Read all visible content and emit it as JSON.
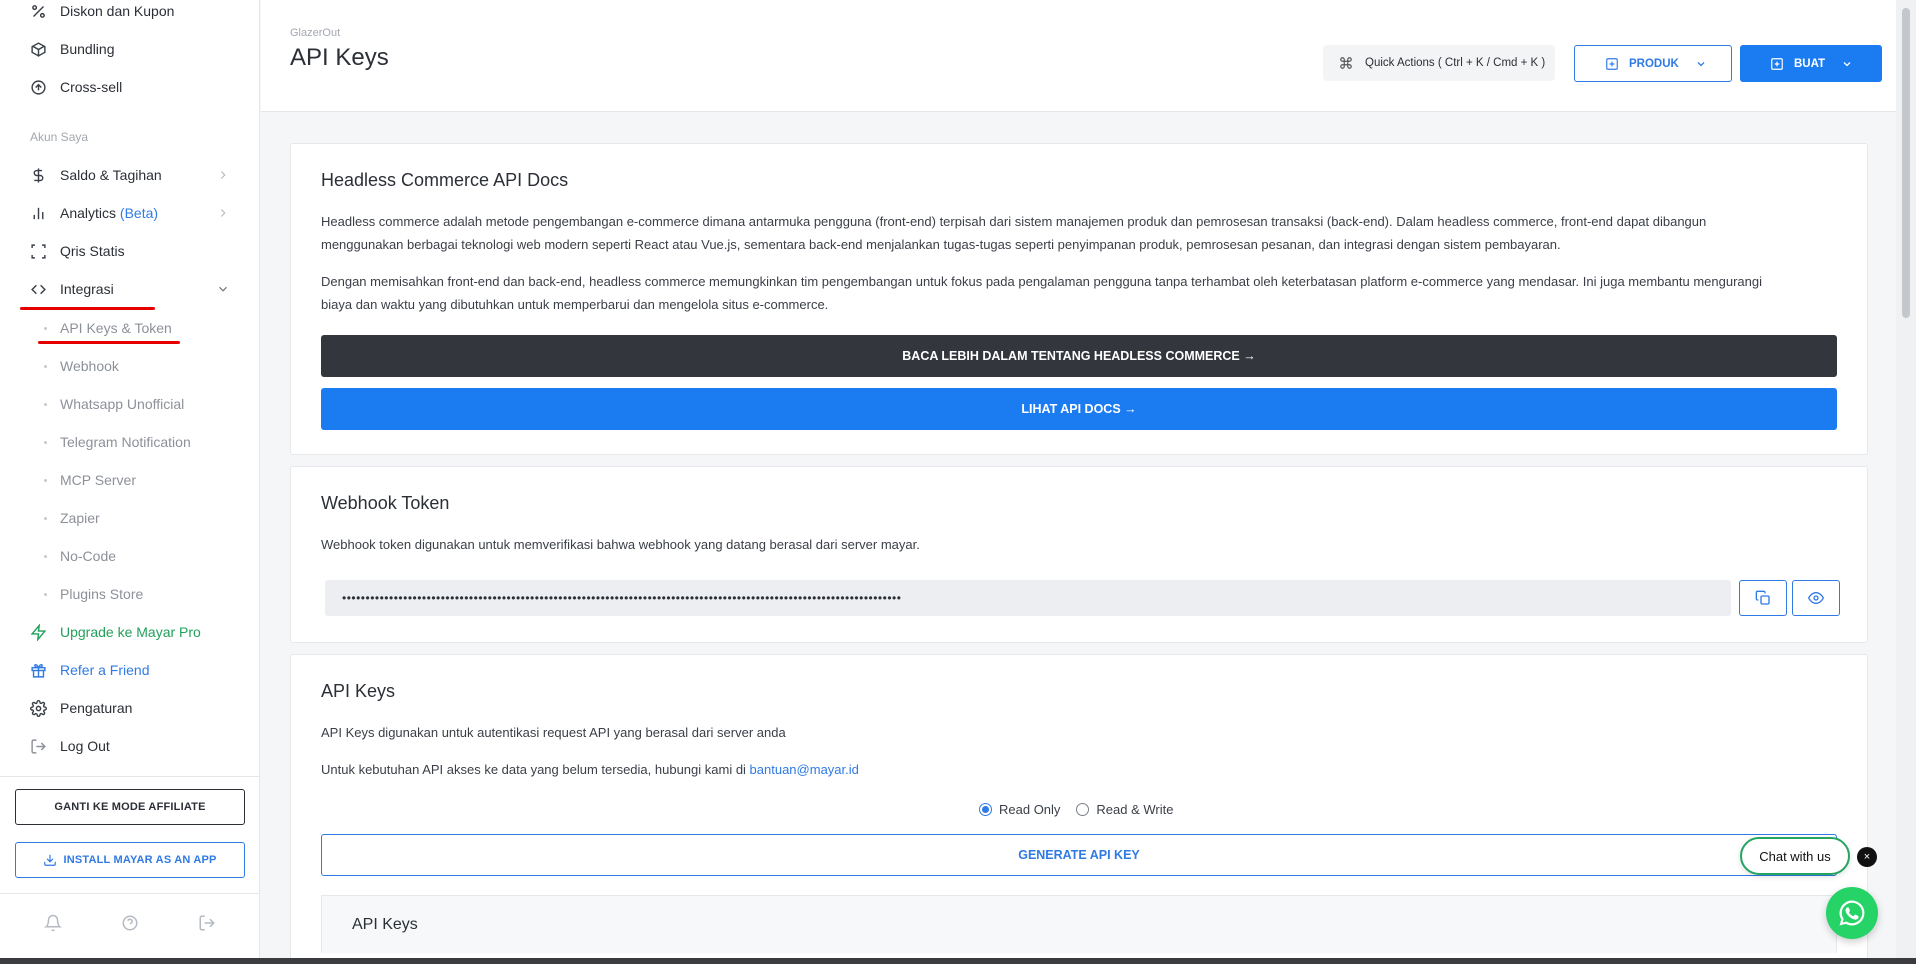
{
  "sidebar": {
    "items_top": [
      {
        "label": "Diskon dan Kupon",
        "icon": "percent-icon"
      },
      {
        "label": "Bundling",
        "icon": "box-icon"
      },
      {
        "label": "Cross-sell",
        "icon": "arrow-up-circle-icon"
      }
    ],
    "section_label": "Akun Saya",
    "items_account": [
      {
        "label": "Saldo & Tagihan",
        "icon": "dollar-icon"
      },
      {
        "label": "Analytics ",
        "beta": "(Beta)",
        "icon": "bar-chart-icon"
      },
      {
        "label": "Qris Statis",
        "icon": "scan-icon"
      },
      {
        "label": "Integrasi",
        "icon": "code-icon"
      }
    ],
    "sub_items": [
      {
        "label": "API Keys & Token"
      },
      {
        "label": "Webhook"
      },
      {
        "label": "Whatsapp Unofficial"
      },
      {
        "label": "Telegram Notification"
      },
      {
        "label": "MCP Server"
      },
      {
        "label": "Zapier"
      },
      {
        "label": "No-Code"
      },
      {
        "label": "Plugins Store"
      }
    ],
    "items_bottom": [
      {
        "label": "Upgrade ke Mayar Pro",
        "icon": "lightning-icon"
      },
      {
        "label": "Refer a Friend",
        "icon": "gift-icon"
      },
      {
        "label": "Pengaturan",
        "icon": "gear-icon"
      },
      {
        "label": "Log Out",
        "icon": "logout-icon"
      }
    ],
    "affiliate_button": "GANTI KE MODE AFFILIATE",
    "install_button": "INSTALL MAYAR AS AN APP"
  },
  "header": {
    "store_name": "GlazerOut",
    "title": "API Keys",
    "quick_actions": "Quick Actions ( Ctrl + K / Cmd + K )",
    "produk_button": "PRODUK",
    "buat_button": "BUAT"
  },
  "headless": {
    "title": "Headless Commerce API Docs",
    "para1": "Headless commerce adalah metode pengembangan e-commerce dimana antarmuka pengguna (front-end) terpisah dari sistem manajemen produk dan pemrosesan transaksi (back-end). Dalam headless commerce, front-end dapat dibangun menggunakan berbagai teknologi web modern seperti React atau Vue.js, sementara back-end menjalankan tugas-tugas seperti penyimpanan produk, pemrosesan pesanan, dan integrasi dengan sistem pembayaran.",
    "para2": "Dengan memisahkan front-end dan back-end, headless commerce memungkinkan tim pengembangan untuk fokus pada pengalaman pengguna tanpa terhambat oleh keterbatasan platform e-commerce yang mendasar. Ini juga membantu mengurangi biaya dan waktu yang dibutuhkan untuk memperbarui dan mengelola situs e-commerce.",
    "read_more_button": "BACA LEBIH DALAM TENTANG HEADLESS COMMERCE →",
    "docs_button": "LIHAT API DOCS →"
  },
  "webhook": {
    "title": "Webhook Token",
    "description": "Webhook token digunakan untuk memverifikasi bahwa webhook yang datang berasal dari server mayar.",
    "token_value": "•••••••••••••••••••••••••••••••••••••••••••••••••••••••••••••••••••••••••••••••••••••••••••••••••••••••••••••••••••••••"
  },
  "api_keys": {
    "title": "API Keys",
    "description": "API Keys digunakan untuk autentikasi request API yang berasal dari server anda",
    "contact_text": "Untuk kebutuhan API akses ke data yang belum tersedia, hubungi kami di ",
    "contact_email": "bantuan@mayar.id",
    "radio_read_only": "Read Only",
    "radio_read_write": "Read & Write",
    "selected_scope": "Read Only",
    "generate_button": "GENERATE API KEY",
    "list_title": "API Keys"
  },
  "chat": {
    "label": "Chat with us",
    "close": "×"
  },
  "colors": {
    "accent": "#1b7cf2",
    "dark_button": "#33373d",
    "success": "#22a05a",
    "whatsapp": "#25d366",
    "annotation": "#e60000"
  }
}
